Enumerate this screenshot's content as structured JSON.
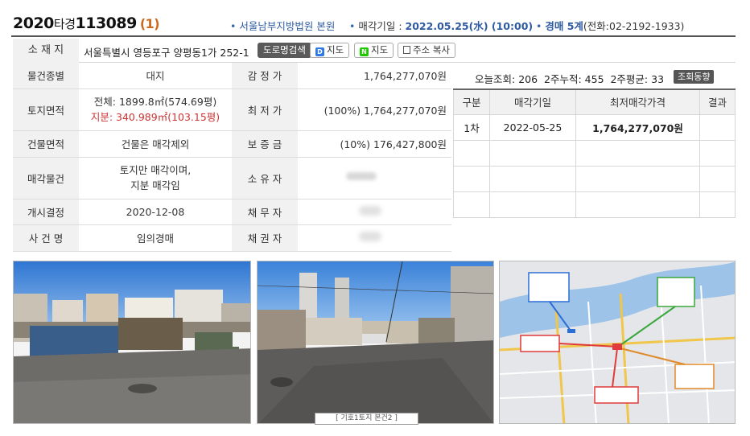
{
  "header": {
    "case_year": "2020",
    "case_type": "타경",
    "case_number": "113089",
    "case_count": "(1)",
    "court": "서울남부지방법원 본원",
    "sale_date_label": "매각기일 :",
    "sale_date": "2022.05.25(水) (10:00)",
    "division": "경매 5계",
    "phone": "(전화:02-2192-1933)"
  },
  "address": {
    "label": "소 재 지",
    "value": "서울특별시 영등포구 양평동1가 252-1",
    "road_search_label": "도로명검색",
    "daum_map_label": "지도",
    "naver_map_label": "지도",
    "copy_label": "주소 복사"
  },
  "details": {
    "rows": [
      {
        "label": "물건종별",
        "value": "대지",
        "label2": "감 정 가",
        "value2": "1,764,277,070원"
      },
      {
        "label": "토지면적",
        "value_line1": "전체: 1899.8㎡(574.69평)",
        "value_line2": "지분: 340.989㎡(103.15평)",
        "label2": "최 저 가",
        "value2": "(100%) 1,764,277,070원"
      },
      {
        "label": "건물면적",
        "value": "건물은 매각제외",
        "label2": "보 증 금",
        "value2": "(10%) 176,427,800원"
      },
      {
        "label": "매각물건",
        "value_line1": "토지만 매각이며,",
        "value_line2": "지분 매각임",
        "label2": "소 유 자",
        "value2": "••••"
      },
      {
        "label": "개시결정",
        "value": "2020-12-08",
        "label2": "채 무 자",
        "value2": "•••"
      },
      {
        "label": "사 건 명",
        "value": "임의경매",
        "label2": "채 권 자",
        "value2": "•••"
      }
    ]
  },
  "stats": {
    "today_label": "오늘조회:",
    "today": "206",
    "twoweek_label": "2주누적:",
    "twoweek": "455",
    "avg_label": "2주평균:",
    "avg": "33",
    "trend_button": "조회동향"
  },
  "schedule": {
    "headers": [
      "구분",
      "매각기일",
      "최저매각가격",
      "결과"
    ],
    "rows": [
      {
        "round": "1차",
        "date": "2022-05-25",
        "price": "1,764,277,070원",
        "result": ""
      }
    ]
  },
  "photos": {
    "caption": "[ 기호1토지 본건2 ]"
  },
  "colors": {
    "accent_blue": "#2e5aa0",
    "count_orange": "#cc6a1e",
    "red_text": "#cc3333",
    "label_bg": "#f1f1f1"
  }
}
